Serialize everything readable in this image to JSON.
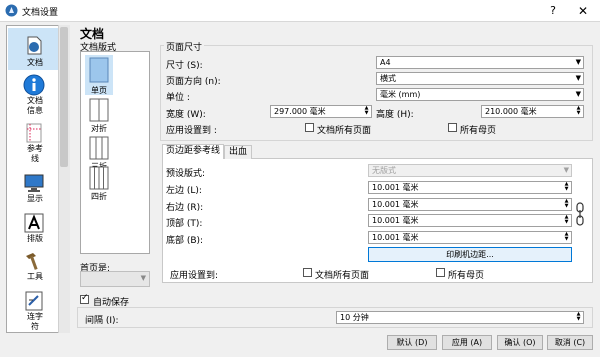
{
  "window": {
    "title": "文档设置",
    "help": "?",
    "close": "✕"
  },
  "nav": {
    "items": [
      {
        "label": "文档",
        "icon": "document-icon"
      },
      {
        "label": "文档\n信息",
        "icon": "info-icon"
      },
      {
        "label": "参考\n线",
        "icon": "guides-icon"
      },
      {
        "label": "显示",
        "icon": "display-icon"
      },
      {
        "label": "排版",
        "icon": "typography-icon"
      },
      {
        "label": "工具",
        "icon": "tools-icon"
      },
      {
        "label": "连字\n符",
        "icon": "hyphenation-icon"
      }
    ]
  },
  "panel": {
    "title": "文档",
    "doc_layout_label": "文档版式",
    "layouts": [
      {
        "label": "单页"
      },
      {
        "label": "对折"
      },
      {
        "label": "三折"
      },
      {
        "label": "四折"
      }
    ],
    "first_page_label": "首页是:",
    "first_page_value": ""
  },
  "page_size": {
    "group_title": "页面尺寸",
    "size_label": "尺寸 (S):",
    "size_value": "A4",
    "orientation_label": "页面方向 (n):",
    "orientation_value": "横式",
    "units_label": "单位 :",
    "units_value": "毫米 (mm)",
    "width_label": "宽度 (W):",
    "width_value": "297.000 毫米",
    "height_label": "高度 (H):",
    "height_value": "210.000 毫米",
    "apply_label": "应用设置到 :",
    "apply_all_doc_pages": "文档所有页面",
    "apply_all_master_pages": "所有母页"
  },
  "tabs": [
    {
      "label": "页边距参考线"
    },
    {
      "label": "出血"
    }
  ],
  "margins": {
    "preset_label": "预设版式:",
    "preset_value": "无版式",
    "left_label": "左边 (L):",
    "left_value": "10.001 毫米",
    "right_label": "右边 (R):",
    "right_value": "10.001 毫米",
    "top_label": "顶部 (T):",
    "top_value": "10.001 毫米",
    "bottom_label": "底部 (B):",
    "bottom_value": "10.001 毫米",
    "printer_margins_button": "印刷机边距...",
    "apply_label": "应用设置到:",
    "apply_all_doc_pages": "文档所有页面",
    "apply_all_master_pages": "所有母页"
  },
  "autosave": {
    "label": "自动保存",
    "checked": true,
    "interval_label": "间隔 (I):",
    "interval_value": "10 分钟"
  },
  "buttons": {
    "default": "默认 (D)",
    "apply": "应用 (A)",
    "ok": "确认 (O)",
    "cancel": "取消 (C)"
  }
}
